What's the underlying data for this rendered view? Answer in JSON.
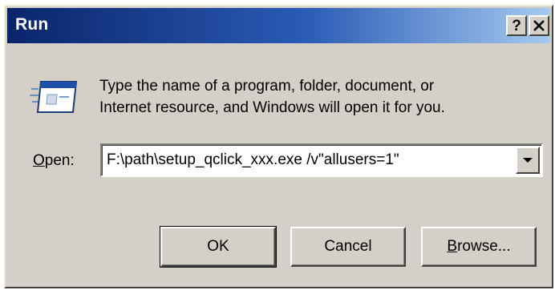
{
  "window": {
    "title": "Run",
    "help_label": "?",
    "close_label": "✕"
  },
  "description": {
    "line1": "Type the name of a program, folder, document, or",
    "line2": "Internet resource, and Windows will open it for you."
  },
  "open_field": {
    "label_underlined": "O",
    "label_rest": "pen:",
    "value": "F:\\path\\setup_qclick_xxx.exe /v\"allusers=1\""
  },
  "buttons": {
    "ok_label": "OK",
    "cancel_label": "Cancel",
    "browse_underlined": "B",
    "browse_rest": "rowse..."
  },
  "icons": {
    "run": "run-program-icon",
    "dropdown": "chevron-down-icon"
  },
  "colors": {
    "titlebar_start": "#0a246a",
    "titlebar_end": "#a6caf0",
    "face": "#d4d0c8"
  }
}
